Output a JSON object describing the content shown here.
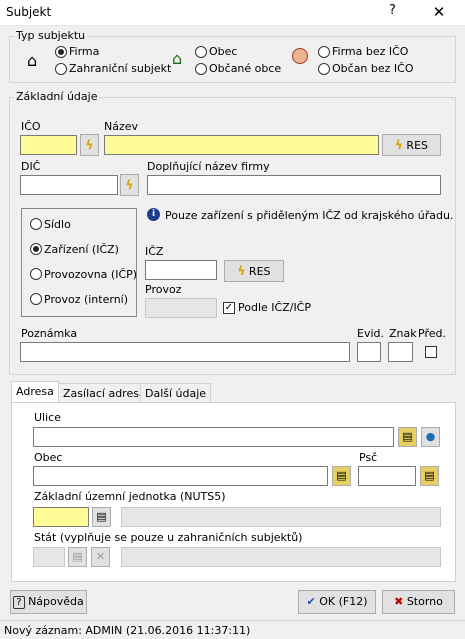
{
  "window": {
    "title": "Subjekt",
    "help_glyph": "?",
    "close_glyph": "✕"
  },
  "typ": {
    "label": "Typ subjektu",
    "firma": "Firma",
    "zahranicni": "Zahraniční subjekt",
    "obec": "Obec",
    "obcane": "Občané obce",
    "firma_bez": "Firma bez IČO",
    "obcan_bez": "Občan bez IČO"
  },
  "zakladni": {
    "label": "Základní údaje",
    "ico_label": "IČO",
    "nazev_label": "Název",
    "res": "RES",
    "dic_label": "DIČ",
    "doplnujici_label": "Doplňující název firmy",
    "sidlo": "Sídlo",
    "zarizeni": "Zařízení (IČZ)",
    "provozovna": "Provozovna (IČP)",
    "provoz": "Provoz (interní)",
    "info": "Pouze zařízení s přiděleným IČZ od krajského úřadu.",
    "icz_label": "IČZ",
    "provoz_label": "Provoz",
    "podle": "Podle IČZ/IČP",
    "poznamka_label": "Poznámka",
    "evid_label": "Evid.",
    "znak_label": "Znak",
    "pred_label": "Před."
  },
  "tabs": [
    "Adresa",
    "Zasílací adresa",
    "Další údaje"
  ],
  "adresa": {
    "ulice": "Ulice",
    "obec": "Obec",
    "psc": "Psč",
    "zuj": "Základní územní jednotka (NUTS5)",
    "stat": "Stát (vyplňuje se pouze u zahraničních subjektů)"
  },
  "buttons": {
    "napoveda": "Nápověda",
    "ok": "OK (F12)",
    "storno": "Storno"
  },
  "status": "Nový záznam: ADMIN (21.06.2016 11:37:11)",
  "colors": {
    "yellow": "#fffb96",
    "ok": "#1f4fb5",
    "storno": "#c00000"
  }
}
